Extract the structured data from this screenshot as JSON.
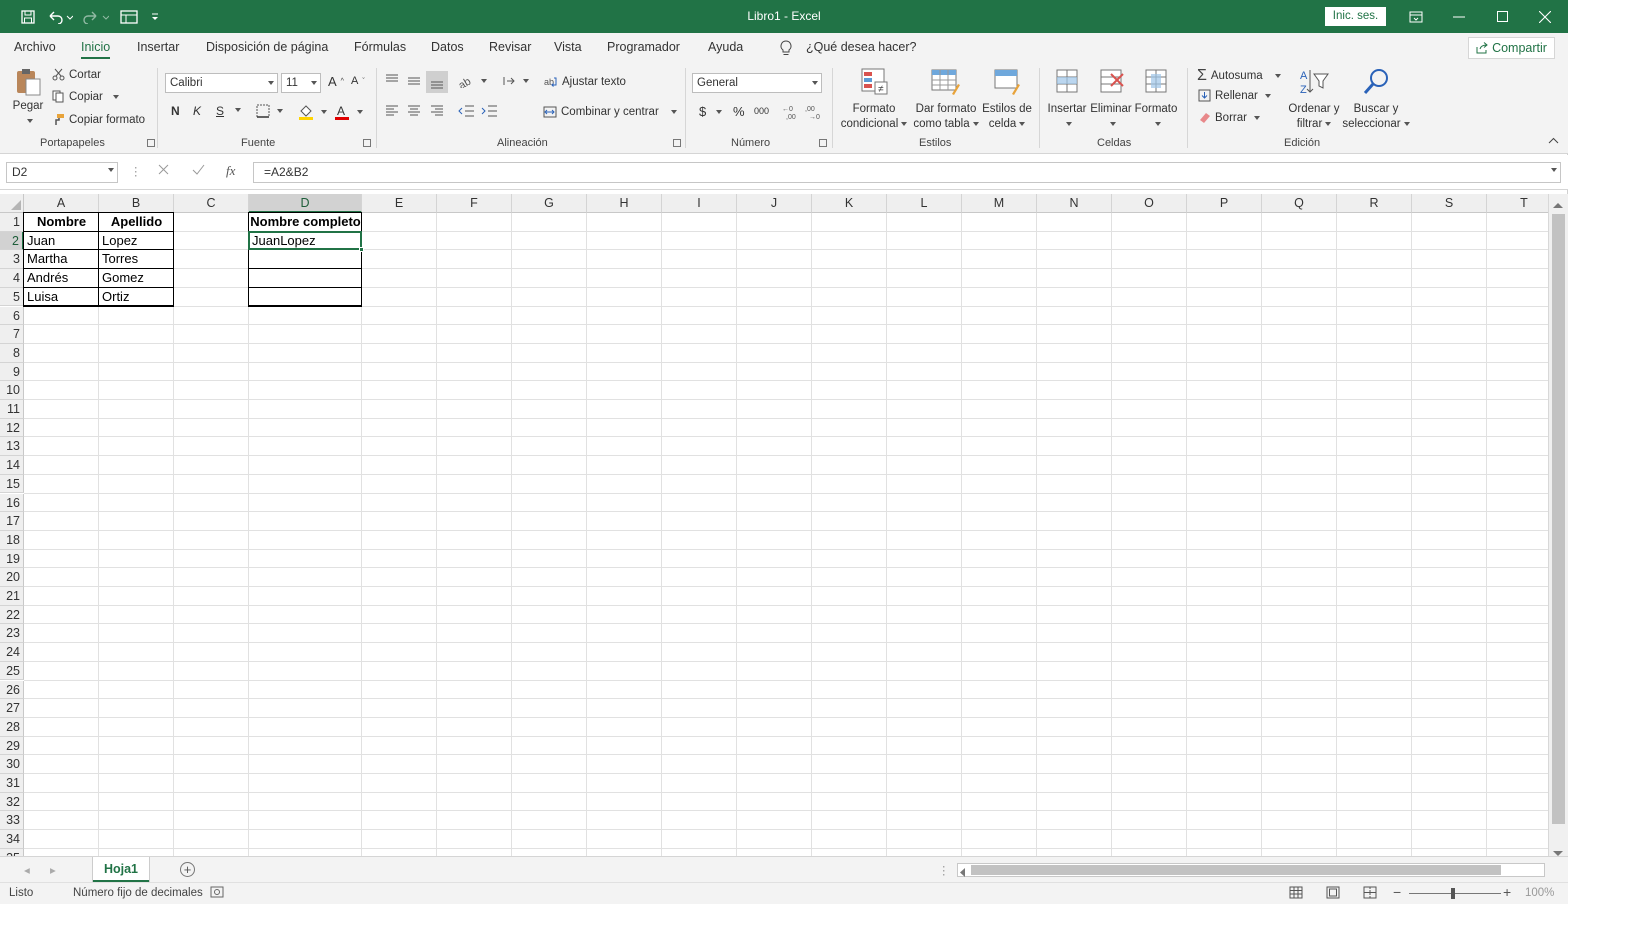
{
  "window": {
    "title": "Libro1 - Excel",
    "signin_label": "Inic. ses."
  },
  "menu": {
    "tabs": [
      "Archivo",
      "Inicio",
      "Insertar",
      "Disposición de página",
      "Fórmulas",
      "Datos",
      "Revisar",
      "Vista",
      "Programador",
      "Ayuda"
    ],
    "active_tab": "Inicio",
    "tell_me": "¿Qué desea hacer?",
    "share_label": "Compartir"
  },
  "ribbon": {
    "clipboard": {
      "paste": "Pegar",
      "cut": "Cortar",
      "copy": "Copiar",
      "format_painter": "Copiar formato",
      "label": "Portapapeles"
    },
    "font": {
      "name": "Calibri",
      "size": "11",
      "bold": "N",
      "italic": "K",
      "underline": "S",
      "label": "Fuente"
    },
    "alignment": {
      "wrap": "Ajustar texto",
      "merge": "Combinar y centrar",
      "label": "Alineación"
    },
    "number": {
      "format": "General",
      "currency": "$",
      "percent": "%",
      "thousands": "000",
      "label": "Número"
    },
    "styles": {
      "conditional": [
        "Formato",
        "condicional"
      ],
      "table": [
        "Dar formato",
        "como tabla"
      ],
      "cell": [
        "Estilos de",
        "celda"
      ],
      "label": "Estilos"
    },
    "cells": {
      "insert": "Insertar",
      "delete": "Eliminar",
      "format": "Formato",
      "label": "Celdas"
    },
    "editing": {
      "autosum": "Autosuma",
      "fill": "Rellenar",
      "clear": "Borrar",
      "sort": [
        "Ordenar y",
        "filtrar"
      ],
      "find": [
        "Buscar y",
        "seleccionar"
      ],
      "label": "Edición"
    }
  },
  "formula_bar": {
    "name_box": "D2",
    "formula": "=A2&B2"
  },
  "columns": [
    "A",
    "B",
    "C",
    "D",
    "E",
    "F",
    "G",
    "H",
    "I",
    "J",
    "K",
    "L",
    "M",
    "N",
    "O",
    "P",
    "Q",
    "R",
    "S",
    "T"
  ],
  "selected_column": "D",
  "selected_row": 2,
  "rows_visible": 34,
  "cells": {
    "A1": "Nombre",
    "B1": "Apellido",
    "D1": "Nombre completo",
    "A2": "Juan",
    "B2": "Lopez",
    "D2": "JuanLopez",
    "A3": "Martha",
    "B3": "Torres",
    "A4": "Andrés",
    "B4": " Gomez",
    "A5": "Luisa",
    "B5": "Ortiz"
  },
  "sheets": {
    "tabs": [
      "Hoja1"
    ],
    "active": "Hoja1"
  },
  "status": {
    "ready": "Listo",
    "fixed_decimal": "Número fijo de decimales",
    "zoom": "100%"
  },
  "colors": {
    "accent": "#217346",
    "selection": "#217346"
  }
}
